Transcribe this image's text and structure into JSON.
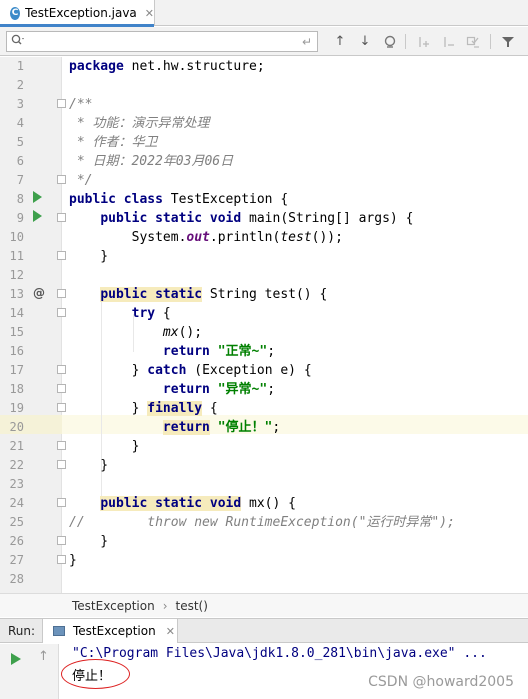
{
  "tab": {
    "icon_letter": "C",
    "name": "TestException.java",
    "close": "✕"
  },
  "search": {
    "placeholder": "",
    "icon": "search-icon"
  },
  "editor": {
    "line_numbers": [
      "1",
      "2",
      "3",
      "4",
      "5",
      "6",
      "7",
      "8",
      "9",
      "10",
      "11",
      "12",
      "13",
      "14",
      "15",
      "16",
      "17",
      "18",
      "19",
      "20",
      "21",
      "22",
      "23",
      "24",
      "25",
      "26",
      "27",
      "28"
    ],
    "lines": [
      [
        {
          "t": "package",
          "c": "kw"
        },
        {
          "t": " net.hw.structure;"
        }
      ],
      [],
      [
        {
          "t": "/**",
          "c": "cm"
        }
      ],
      [
        {
          "t": " * 功能：演示异常处理",
          "c": "cm"
        }
      ],
      [
        {
          "t": " * 作者：华卫",
          "c": "cm"
        }
      ],
      [
        {
          "t": " * 日期：2022年03月06日",
          "c": "cm"
        }
      ],
      [
        {
          "t": " */",
          "c": "cm"
        }
      ],
      [
        {
          "t": "public class",
          "c": "kw"
        },
        {
          "t": " TestException {"
        }
      ],
      [
        {
          "t": "    "
        },
        {
          "t": "public static void",
          "c": "kw"
        },
        {
          "t": " main(String[] args) {"
        }
      ],
      [
        {
          "t": "        System."
        },
        {
          "t": "out",
          "c": "fld"
        },
        {
          "t": ".println("
        },
        {
          "t": "test",
          "c": "it"
        },
        {
          "t": "());"
        }
      ],
      [
        {
          "t": "    }"
        }
      ],
      [],
      [
        {
          "t": "    "
        },
        {
          "t": "public static",
          "c": "kw hl"
        },
        {
          "t": " String test() {"
        }
      ],
      [
        {
          "t": "        "
        },
        {
          "t": "try",
          "c": "kw"
        },
        {
          "t": " {"
        }
      ],
      [
        {
          "t": "            "
        },
        {
          "t": "mx",
          "c": "it"
        },
        {
          "t": "();"
        }
      ],
      [
        {
          "t": "            "
        },
        {
          "t": "return",
          "c": "kw"
        },
        {
          "t": " "
        },
        {
          "t": "\"正常~\"",
          "c": "str"
        },
        {
          "t": ";"
        }
      ],
      [
        {
          "t": "        } "
        },
        {
          "t": "catch",
          "c": "kw"
        },
        {
          "t": " (Exception e) {"
        }
      ],
      [
        {
          "t": "            "
        },
        {
          "t": "return",
          "c": "kw"
        },
        {
          "t": " "
        },
        {
          "t": "\"异常~\"",
          "c": "str"
        },
        {
          "t": ";"
        }
      ],
      [
        {
          "t": "        } "
        },
        {
          "t": "finally",
          "c": "kw hl"
        },
        {
          "t": " {"
        }
      ],
      [
        {
          "t": "            "
        },
        {
          "t": "return",
          "c": "kw hl"
        },
        {
          "t": " "
        },
        {
          "t": "\"停止！\"",
          "c": "str"
        },
        {
          "t": ";"
        }
      ],
      [
        {
          "t": "        }"
        }
      ],
      [
        {
          "t": "    }"
        }
      ],
      [],
      [
        {
          "t": "    "
        },
        {
          "t": "public static void",
          "c": "kw hl"
        },
        {
          "t": " mx() {"
        }
      ],
      [
        {
          "t": "//        throw new RuntimeException(\"运行时异常\");",
          "c": "cm"
        }
      ],
      [
        {
          "t": "    }"
        }
      ],
      [
        {
          "t": "}"
        }
      ],
      []
    ]
  },
  "breadcrumb": {
    "items": [
      "TestException",
      "test()"
    ],
    "separator": "›"
  },
  "run": {
    "label": "Run:",
    "tab_name": "TestException",
    "tab_close": "✕",
    "output_line1": "\"C:\\Program Files\\Java\\jdk1.8.0_281\\bin\\java.exe\" ...",
    "output_line2": "停止！"
  },
  "watermark": "CSDN @howard2005"
}
